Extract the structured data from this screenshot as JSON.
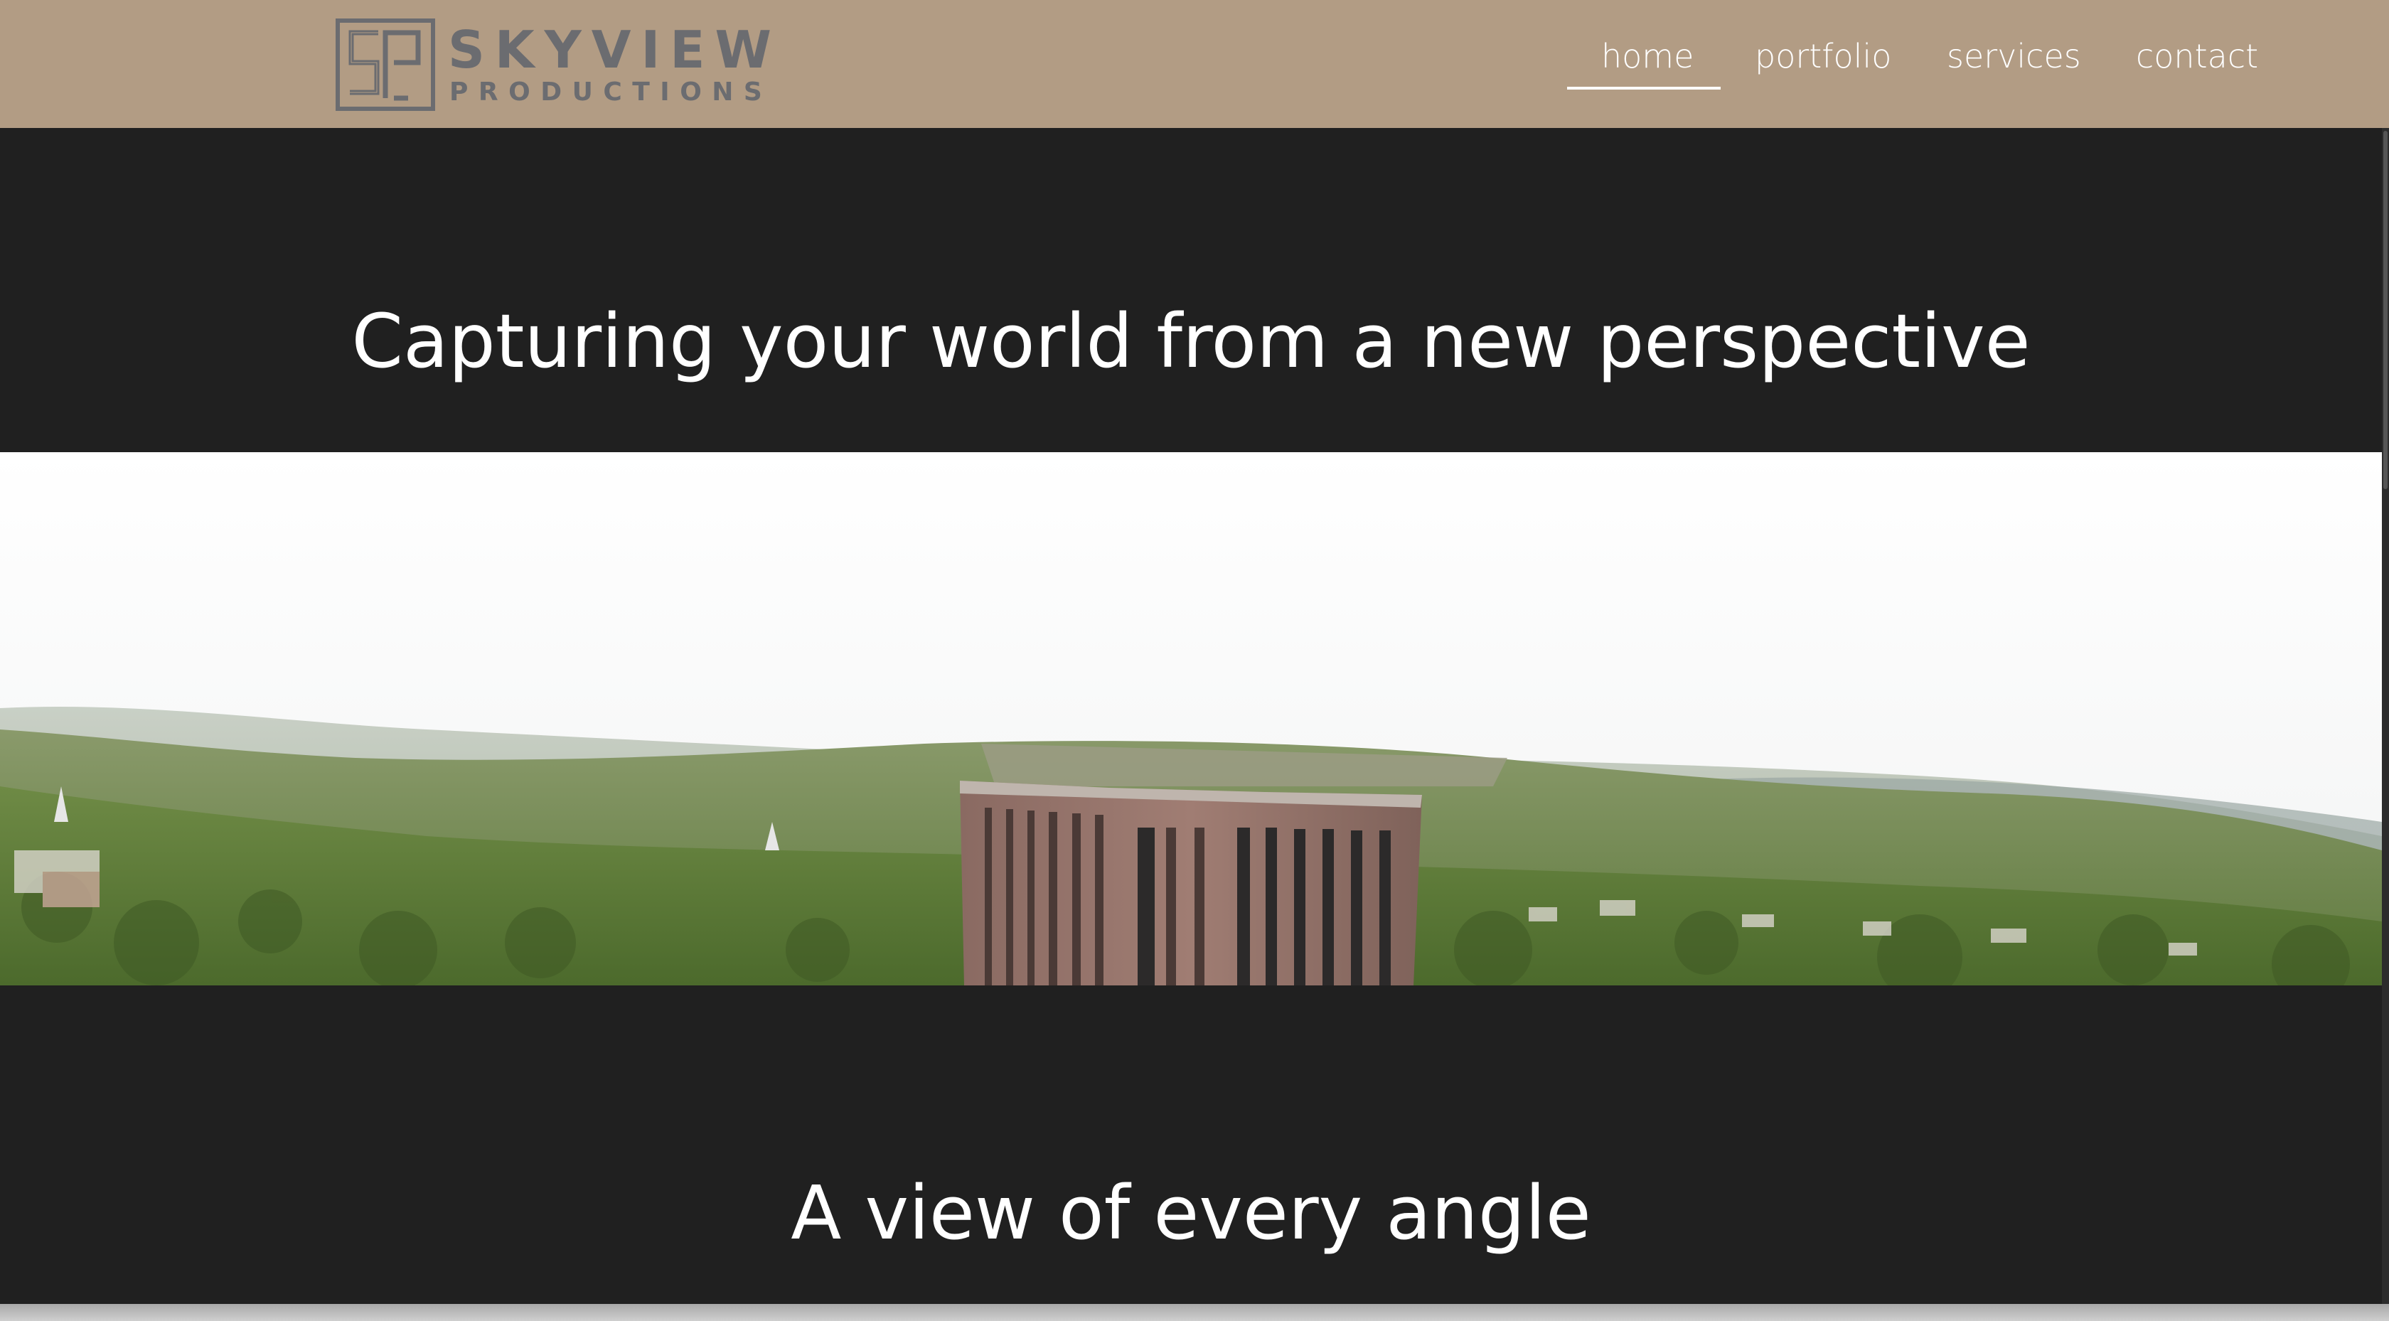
{
  "brand": {
    "mark": "SP",
    "name": "SKYVIEW",
    "tagline": "PRODUCTIONS"
  },
  "nav": {
    "items": [
      {
        "label": "home",
        "active": true
      },
      {
        "label": "portfolio",
        "active": false
      },
      {
        "label": "services",
        "active": false
      },
      {
        "label": "contact",
        "active": false
      }
    ]
  },
  "hero": {
    "headline": "Capturing your world from a new perspective"
  },
  "image": {
    "description_icon": "aerial-photo"
  },
  "section2": {
    "headline": "A view of every angle"
  },
  "colors": {
    "header_bg": "#b29c84",
    "page_bg": "#202020",
    "logo_gray": "#6b6c70",
    "text": "#ffffff"
  }
}
